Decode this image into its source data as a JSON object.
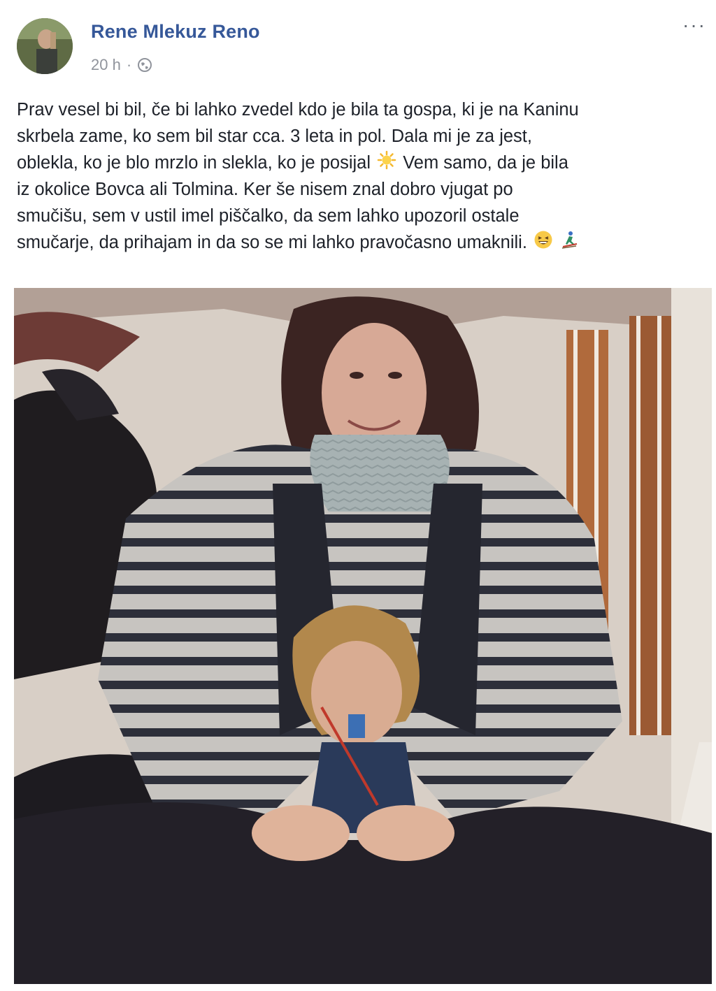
{
  "post": {
    "author": "Rene Mlekuz Reno",
    "time": "20 h",
    "separator": "·",
    "more_label": "···",
    "text_lines": [
      "Prav vesel bi bil, če bi lahko zvedel kdo je bila ta gospa, ki je na Kaninu",
      "skrbela zame, ko sem bil star cca. 3 leta in pol. Dala mi je za jest,",
      "oblekla, ko je blo mrzlo in slekla, ko je posijal",
      "iz okolice Bovca ali Tolmina. Ker še nisem znal dobro vjugat po",
      "smučišu, sem v ustil imel piščalko, da sem lahko upozoril ostale",
      "smučarje, da prihajam in da so se mi lahko pravočasno umaknili."
    ],
    "text_after_sun": "Vem samo, da je bila",
    "icons": {
      "avatar": "avatar-photo",
      "privacy": "globe-icon",
      "sun_emoji": "sun-emoji-icon",
      "laugh_emoji": "laughing-emoji-icon",
      "ski_emoji": "skier-emoji-icon"
    },
    "colors": {
      "author": "#365899",
      "meta": "#90949c",
      "text": "#1d2129"
    }
  }
}
